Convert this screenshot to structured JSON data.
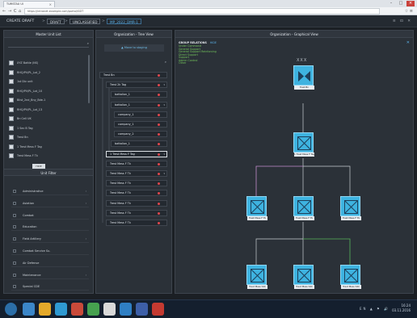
{
  "browser": {
    "tab_title": "TUMSTAU UI",
    "tab_close": "×",
    "url": "https://intranet.example.com/portal/GDT",
    "back": "←",
    "forward": "→",
    "reload": "C",
    "home": "⌂",
    "bookmark": "☆",
    "menu": "≡",
    "min": "–",
    "max": "□",
    "close": "×"
  },
  "toolbar": {
    "crumbs": [
      "CREATE DRAFT",
      "DRAFT",
      "UNCLASSIFIED",
      "MP_2022_DMR-1"
    ],
    "sep": ">",
    "right_icons": "≡ ⊡ ✕"
  },
  "master_list": {
    "title": "Master Unit List",
    "search_icon": "🔍",
    "items": [
      "XYZ Battle (NS)",
      "RHQ/PV/PL_Lot_2",
      "1st Div unit",
      "RHQ/PV/PL_Lot_10",
      "Blist_2nd_Bny_Bde-1",
      "RHQ/PV/PL_Lot_13",
      "Bn Cell UK",
      "1 Sec B Tag",
      "Trest Bn",
      "1 Trest Mess F Tag",
      "Trest Mess F Tk"
    ],
    "hide_label": "HIDE",
    "filter_title": "Unit Filter",
    "filters": [
      "Administrative",
      "Aviation",
      "Combat",
      "Education",
      "Field Artillery",
      "Combat Service Su.",
      "Air Defense",
      "Maintenance",
      "Special CDE"
    ],
    "filter_arrow": "›"
  },
  "tree": {
    "title": "Organization - Tree View",
    "action": "Move to staging",
    "search_icon": "🔍",
    "items": [
      "Trest Bn",
      "Trest 2k Tag",
      "battalion_1",
      "battalion_1",
      "company_1",
      "company_1",
      "company_2",
      "battalion_1",
      "1 Trest Mess F Tag",
      "Trest Mess F Tk",
      "Trest Mess F Tk",
      "Trest Mess F Tk",
      "Trest Mess F Tk",
      "Trest Mess F Tk",
      "Trest Mess F Tk",
      "Trest Mess F Tk"
    ],
    "dropdown": "▾"
  },
  "graph": {
    "title": "Organization - Graphical View",
    "legend_title": "GROUP RELATIONS",
    "legend_link": "HIDE",
    "legend": [
      "Under Command",
      "General Support",
      "General Support Reinforcing",
      "Direct Support",
      "Support",
      "Admin Control",
      "Other"
    ],
    "close_icon": "✕",
    "top_marker": "XXX",
    "nodes": {
      "root": "Trest Bn",
      "mid": "1 Trest Mess F Tag",
      "row2": [
        "Trest Mess F Tk",
        "Trest Mess F Tk",
        "Trest Mess F Tk"
      ],
      "row3": [
        "Trest Mess S4k",
        "Trest Mess S4k",
        "Trest Mess S4k"
      ]
    }
  },
  "taskbar": {
    "time": "16:24",
    "date": "03.11.2016",
    "tray": "EN ▲ ⚑ 🔊"
  },
  "colors": {
    "accent": "#3eb3e0",
    "legend_green": "#72c35a",
    "link_purple": "#c28ccb",
    "link_green": "#58b55a",
    "alert_red": "#e2474d"
  }
}
